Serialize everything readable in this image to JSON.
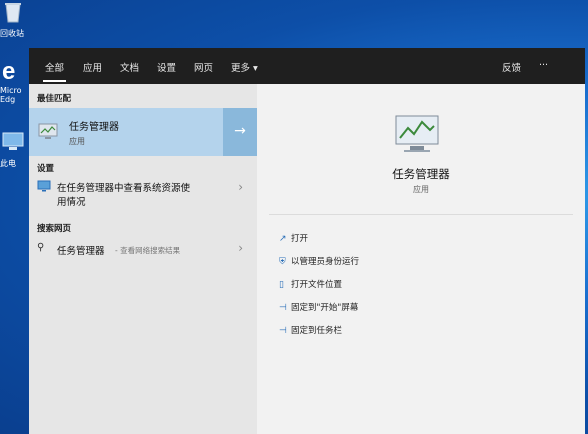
{
  "desktop": {
    "recycle_bin": "回收站",
    "edge_label": "Micro Edg",
    "this_pc": "此电"
  },
  "tabs": [
    "全部",
    "应用",
    "文档",
    "设置",
    "网页",
    "更多 ▾"
  ],
  "top_right": {
    "feedback": "反馈",
    "more": "···"
  },
  "sections": {
    "best_match": "最佳匹配",
    "settings": "设置",
    "web": "搜索网页"
  },
  "best_match": {
    "title": "任务管理器",
    "subtitle": "应用"
  },
  "settings_item": {
    "line1": "在任务管理器中查看系统资源使",
    "line2": "用情况"
  },
  "web_item": {
    "title": "任务管理器",
    "suffix": "- 查看网络搜索结果"
  },
  "detail": {
    "title": "任务管理器",
    "subtitle": "应用"
  },
  "actions": [
    {
      "icon": "open-icon",
      "glyph": "↗",
      "label": "打开"
    },
    {
      "icon": "shield-icon",
      "glyph": "⛨",
      "label": "以管理员身份运行"
    },
    {
      "icon": "folder-icon",
      "glyph": "▯",
      "label": "打开文件位置"
    },
    {
      "icon": "pin-icon",
      "glyph": "⊣",
      "label": "固定到\"开始\"屏幕"
    },
    {
      "icon": "pin-icon",
      "glyph": "⊣",
      "label": "固定到任务栏"
    }
  ]
}
